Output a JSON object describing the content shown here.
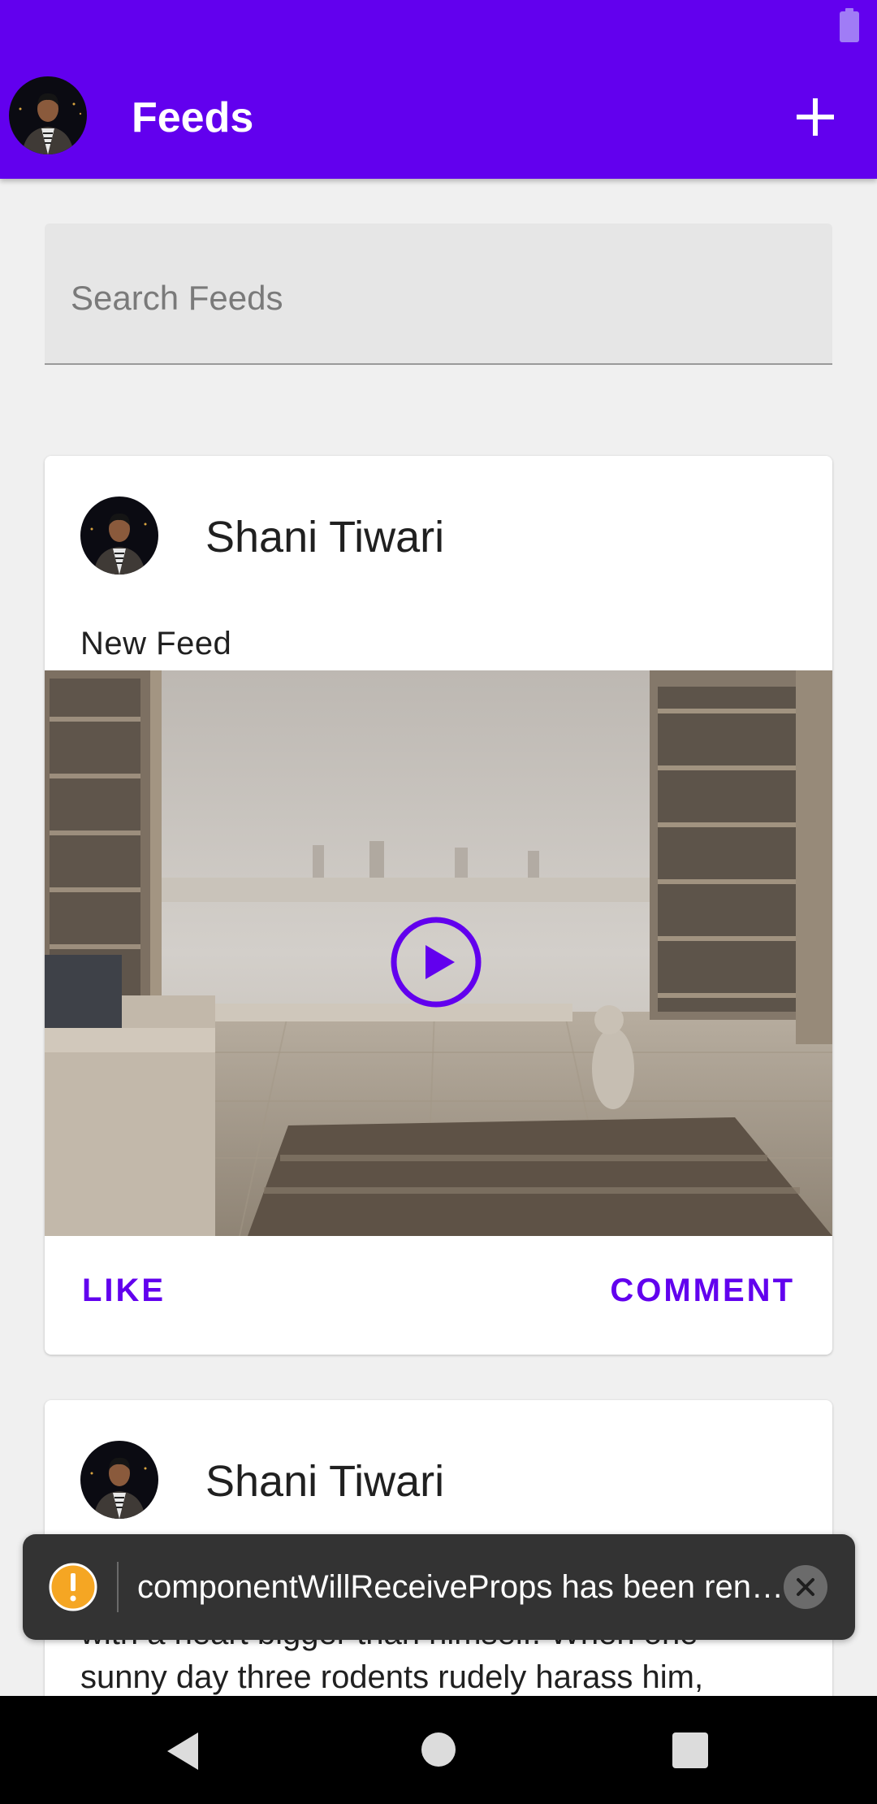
{
  "app_bar": {
    "title": "Feeds",
    "background": "#6200ee",
    "avatar_icon": "user-avatar",
    "add_icon": "plus-icon"
  },
  "search": {
    "placeholder": "Search Feeds",
    "value": ""
  },
  "feed": [
    {
      "author": "Shani Tiwari",
      "text": "New Feed",
      "media": "video-thumbnail",
      "play_icon": "play-circle-icon",
      "like_label": "LIKE",
      "comment_label": "COMMENT"
    },
    {
      "author": "Shani Tiwari",
      "text_line_1": "with a heart bigger than himself. When one",
      "text_line_2": "sunny day three rodents rudely harass him,"
    }
  ],
  "toast": {
    "message": "componentWillReceiveProps has been renamed, and is not recommended for use in production code.",
    "icon": "warning-icon",
    "dismiss_icon": "close-icon"
  },
  "nav_bar": {
    "back_icon": "back-icon",
    "home_icon": "home-icon",
    "recents_icon": "recents-icon"
  },
  "colors": {
    "accent": "#6200ee",
    "warning": "#f5a623"
  }
}
